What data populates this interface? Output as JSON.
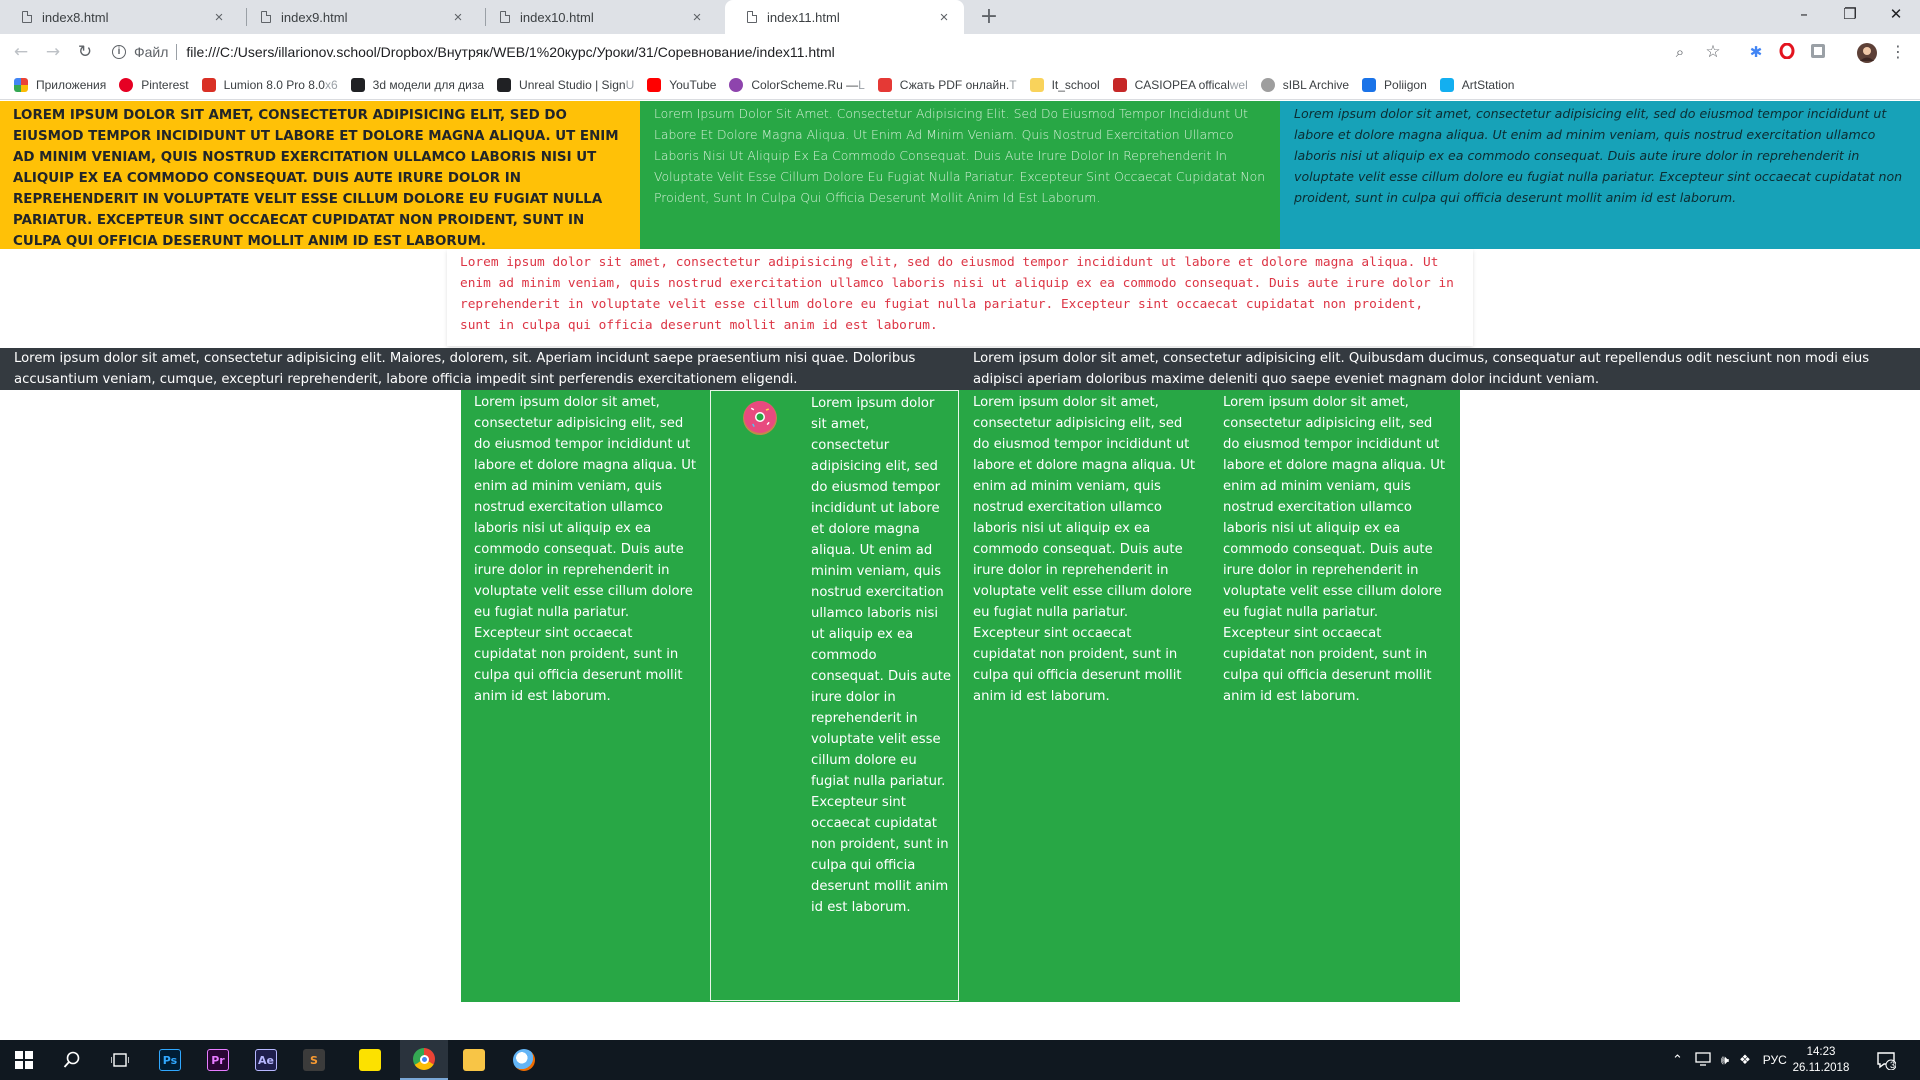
{
  "browser": {
    "tabs": [
      {
        "label": "index8.html",
        "active": false
      },
      {
        "label": "index9.html",
        "active": false
      },
      {
        "label": "index10.html",
        "active": false
      },
      {
        "label": "index11.html",
        "active": true
      }
    ],
    "tab_close_glyph": "×",
    "new_tab_glyph": "+",
    "window_controls": {
      "minimize": "–",
      "maximize": "❐",
      "close": "✕"
    },
    "address_scheme": "Файл",
    "address_url": "file:///C:/Users/illarionov.school/Dropbox/Внутряк/WEB/1%20курс/Уроки/31/Соревнование/index11.html",
    "bookmarks": [
      {
        "label": "Приложения",
        "icon": "apps-grid-icon",
        "color": "#ea4335"
      },
      {
        "label": "Pinterest",
        "icon": "pinterest-icon",
        "color": "#e60023"
      },
      {
        "label": "Lumion 8.0 Pro 8.0",
        "fade": " x6",
        "icon": "lumion-icon",
        "color": "#d93025"
      },
      {
        "label": "3d модели для диза",
        "fade": "",
        "icon": "3d-models-icon",
        "color": "#202124"
      },
      {
        "label": "Unreal Studio | Sign",
        "fade": " U",
        "icon": "unreal-icon",
        "color": "#202124"
      },
      {
        "label": "YouTube",
        "fade": "",
        "icon": "youtube-icon",
        "color": "#ff0000"
      },
      {
        "label": "ColorScheme.Ru —",
        "fade": " L",
        "icon": "colorscheme-icon",
        "color": "#8e44ad"
      },
      {
        "label": "Сжать PDF онлайн.",
        "fade": " T",
        "icon": "pdf-heart-icon",
        "color": "#e53935"
      },
      {
        "label": "It_school",
        "fade": "",
        "icon": "folder-icon",
        "color": "#f9d35b"
      },
      {
        "label": "CASIOPEA offical",
        "fade": " wel",
        "icon": "casiopea-icon",
        "color": "#c62828"
      },
      {
        "label": "sIBL Archive",
        "fade": "",
        "icon": "sibl-icon",
        "color": "#9e9e9e"
      },
      {
        "label": "Poliigon",
        "fade": "",
        "icon": "poliigon-icon",
        "color": "#1a73e8"
      },
      {
        "label": "ArtStation",
        "fade": "",
        "icon": "artstation-icon",
        "color": "#13aff0"
      }
    ]
  },
  "page": {
    "yellow_text": "Lorem ipsum dolor sit amet, consectetur adipisicing elit, sed do eiusmod tempor incididunt ut labore et dolore magna aliqua. Ut enim ad minim veniam, quis nostrud exercitation ullamco laboris nisi ut aliquip ex ea commodo consequat. Duis aute irure dolor in reprehenderit in voluptate velit esse cillum dolore eu fugiat nulla pariatur. Excepteur sint occaecat cupidatat non proident, sunt in culpa qui officia deserunt mollit anim id est laborum.",
    "green_text": "Lorem Ipsum Dolor Sit Amet. Consectetur Adipisicing Elit. Sed Do Eiusmod Tempor Incididunt Ut Labore Et Dolore Magna Aliqua. Ut Enim Ad Minim Veniam. Quis Nostrud Exercitation Ullamco Laboris Nisi Ut Aliquip Ex Ea Commodo Consequat. Duis Aute Irure Dolor In Reprehenderit In Voluptate Velit Esse Cillum Dolore Eu Fugiat Nulla Pariatur. Excepteur Sint Occaecat Cupidatat Non Proident, Sunt In Culpa Qui Officia Deserunt Mollit Anim Id Est Laborum.",
    "teal_text": "Lorem ipsum dolor sit amet, consectetur adipisicing elit, sed do eiusmod tempor incididunt ut labore et dolore magna aliqua. Ut enim ad minim veniam, quis nostrud exercitation ullamco laboris nisi ut aliquip ex ea commodo consequat. Duis aute irure dolor in reprehenderit in voluptate velit esse cillum dolore eu fugiat nulla pariatur. Excepteur sint occaecat cupidatat non proident, sunt in culpa qui officia deserunt mollit anim id est laborum.",
    "mono_text": "Lorem ipsum dolor sit amet, consectetur adipisicing elit, sed do eiusmod tempor incididunt ut labore et dolore magna aliqua. Ut enim ad minim veniam, quis nostrud exercitation ullamco laboris nisi ut aliquip ex ea commodo consequat. Duis aute irure dolor in reprehenderit in voluptate velit esse cillum dolore eu fugiat nulla pariatur. Excepteur sint occaecat cupidatat non proident, sunt in culpa qui officia deserunt mollit anim id est laborum.",
    "dark_left": "Lorem ipsum dolor sit amet, consectetur adipisicing elit. Maiores, dolorem, sit. Aperiam incidunt saepe praesentium nisi quae. Doloribus accusantium veniam, cumque, excepturi reprehenderit, labore officia impedit sint perferendis exercitationem eligendi.",
    "dark_right": "Lorem ipsum dolor sit amet, consectetur adipisicing elit. Quibusdam ducimus, consequatur aut repellendus odit nesciunt non modi eius adipisci aperiam doloribus maxime deleniti quo saepe eveniet magnam dolor incidunt veniam.",
    "col1": "Lorem ipsum dolor sit amet, consectetur adipisicing elit, sed do eiusmod tempor incididunt ut labore et dolore magna aliqua. Ut enim ad minim veniam, quis nostrud exercitation ullamco laboris nisi ut aliquip ex ea commodo consequat. Duis aute irure dolor in reprehenderit in voluptate velit esse cillum dolore eu fugiat nulla pariatur. Excepteur sint occaecat cupidatat non proident, sunt in culpa qui officia deserunt mollit anim id est laborum.",
    "col2": "Lorem ipsum dolor sit amet, consectetur adipisicing elit, sed do eiusmod tempor incididunt ut labore et dolore magna aliqua. Ut enim ad minim veniam, quis nostrud exercitation ullamco laboris nisi ut aliquip ex ea commodo consequat. Duis aute irure dolor in reprehenderit in voluptate velit esse cillum dolore eu fugiat nulla pariatur. Excepteur sint occaecat cupidatat non proident, sunt in culpa qui officia deserunt mollit anim id est laborum.",
    "col3": "Lorem ipsum dolor sit amet, consectetur adipisicing elit, sed do eiusmod tempor incididunt ut labore et dolore magna aliqua. Ut enim ad minim veniam, quis nostrud exercitation ullamco laboris nisi ut aliquip ex ea commodo consequat. Duis aute irure dolor in reprehenderit in voluptate velit esse cillum dolore eu fugiat nulla pariatur. Excepteur sint occaecat cupidatat non proident, sunt in culpa qui officia deserunt mollit anim id est laborum.",
    "col4": "Lorem ipsum dolor sit amet, consectetur adipisicing elit, sed do eiusmod tempor incididunt ut labore et dolore magna aliqua. Ut enim ad minim veniam, quis nostrud exercitation ullamco laboris nisi ut aliquip ex ea commodo consequat. Duis aute irure dolor in reprehenderit in voluptate velit esse cillum dolore eu fugiat nulla pariatur. Excepteur sint occaecat cupidatat non proident, sunt in culpa qui officia deserunt mollit anim id est laborum.",
    "colors": {
      "yellow": "#ffc107",
      "green": "#28a745",
      "teal": "#17a2b8",
      "dark": "#343a40",
      "red": "#dc3545"
    }
  },
  "taskbar": {
    "apps": [
      {
        "name": "photoshop-icon",
        "label": "Ps",
        "bg": "#001d34",
        "fg": "#31a8ff"
      },
      {
        "name": "premiere-icon",
        "label": "Pr",
        "bg": "#2a0634",
        "fg": "#e77cff"
      },
      {
        "name": "aftereffects-icon",
        "label": "Ae",
        "bg": "#1e1e4c",
        "fg": "#b7b7ff"
      },
      {
        "name": "sublime-icon",
        "label": "S",
        "bg": "#3b3b3b",
        "fg": "#f79a32"
      },
      {
        "name": "sticky-notes-icon",
        "label": "",
        "bg": "#fce100",
        "fg": "#000"
      },
      {
        "name": "chrome-icon",
        "label": "",
        "bg": "#101820",
        "fg": "#fff"
      },
      {
        "name": "file-explorer-icon",
        "label": "",
        "bg": "#f8c546",
        "fg": "#000"
      },
      {
        "name": "paint-icon",
        "label": "",
        "bg": "#101820",
        "fg": "#fff"
      }
    ],
    "language": "РУС",
    "time": "14:23",
    "date": "26.11.2018",
    "notification_count": "3"
  }
}
